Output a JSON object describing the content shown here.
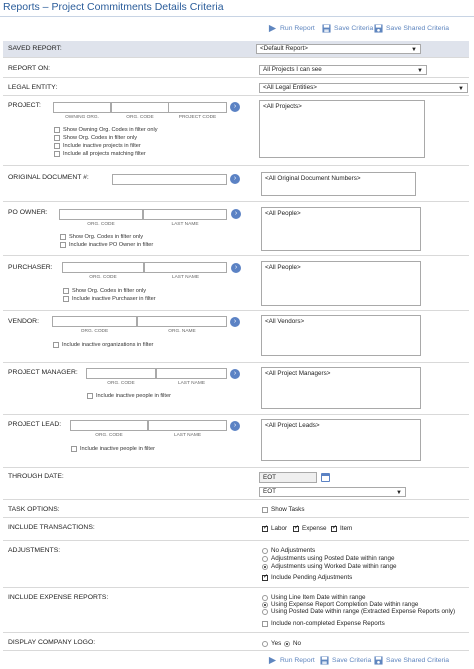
{
  "page": {
    "title": "Reports – Project Commitments Details Criteria"
  },
  "toolbar": {
    "run": "Run Report",
    "save": "Save Criteria",
    "save_shared": "Save Shared Criteria"
  },
  "saved_report": {
    "label": "SAVED REPORT:",
    "value": "<Default Report>"
  },
  "report_on": {
    "label": "REPORT ON:",
    "value": "All Projects I can see"
  },
  "legal_entity": {
    "label": "LEGAL ENTITY:",
    "value": "<All Legal Entities>"
  },
  "project": {
    "label": "PROJECT:",
    "sub": [
      "OWNING ORG.",
      "ORG. CODE",
      "PROJECT CODE"
    ],
    "list": "<All Projects>",
    "checks": [
      "Show Owning Org. Codes in filter only",
      "Show Org. Codes in filter only",
      "Include inactive projects in filter",
      "Include all projects matching filter"
    ]
  },
  "original_document": {
    "label": "ORIGINAL DOCUMENT #:",
    "list": "<All Original Document Numbers>"
  },
  "po_owner": {
    "label": "PO OWNER:",
    "sub": [
      "ORG. CODE",
      "LAST NAME"
    ],
    "list": "<All People>",
    "checks": [
      "Show Org. Codes in filter only",
      "Include inactive PO Owner in filter"
    ]
  },
  "purchaser": {
    "label": "PURCHASER:",
    "sub": [
      "ORG. CODE",
      "LAST NAME"
    ],
    "list": "<All People>",
    "checks": [
      "Show Org. Codes in filter only",
      "Include inactive Purchaser in filter"
    ]
  },
  "vendor": {
    "label": "VENDOR:",
    "sub": [
      "ORG. CODE",
      "ORG. NAME"
    ],
    "list": "<All Vendors>",
    "checks": [
      "Include inactive organizations in filter"
    ]
  },
  "project_manager": {
    "label": "PROJECT MANAGER:",
    "sub": [
      "ORG. CODE",
      "LAST NAME"
    ],
    "list": "<All Project Managers>",
    "checks": [
      "Include inactive people in filter"
    ]
  },
  "project_lead": {
    "label": "PROJECT LEAD:",
    "sub": [
      "ORG. CODE",
      "LAST NAME"
    ],
    "list": "<All Project Leads>",
    "checks": [
      "Include inactive people in filter"
    ]
  },
  "through_date": {
    "label": "THROUGH DATE:",
    "value": "EOT",
    "select": "EOT"
  },
  "task_options": {
    "label": "TASK OPTIONS:",
    "show_tasks": "Show Tasks"
  },
  "include_transactions": {
    "label": "INCLUDE TRANSACTIONS:",
    "options": [
      "Labor",
      "Expense",
      "Item"
    ]
  },
  "adjustments": {
    "label": "ADJUSTMENTS:",
    "options": [
      "No Adjustments",
      "Adjustments using Posted Date within range",
      "Adjustments using Worked Date within range"
    ],
    "selected": 2,
    "pending": "Include Pending Adjustments"
  },
  "include_expense_reports": {
    "label": "INCLUDE EXPENSE REPORTS:",
    "options": [
      "Using Line Item Date within range",
      "Using Expense Report Completion Date within range",
      "Using Posted Date within range (Extracted Expense Reports only)"
    ],
    "selected": 1,
    "noncompleted": "Include non-completed Expense Reports"
  },
  "display_company_logo": {
    "label": "DISPLAY COMPANY LOGO:",
    "yes": "Yes",
    "no": "No"
  },
  "colors": {
    "title": "#2a5c9a",
    "toolbar_link": "#5f86bf",
    "button": "#5b82c4",
    "shaded_row": "#dfe3ec"
  },
  "icons": {
    "run": "run-icon",
    "save": "floppy-disk-icon",
    "save_shared": "shared-floppy-icon",
    "go": "arrow-right-circle-icon",
    "calendar": "calendar-icon"
  }
}
